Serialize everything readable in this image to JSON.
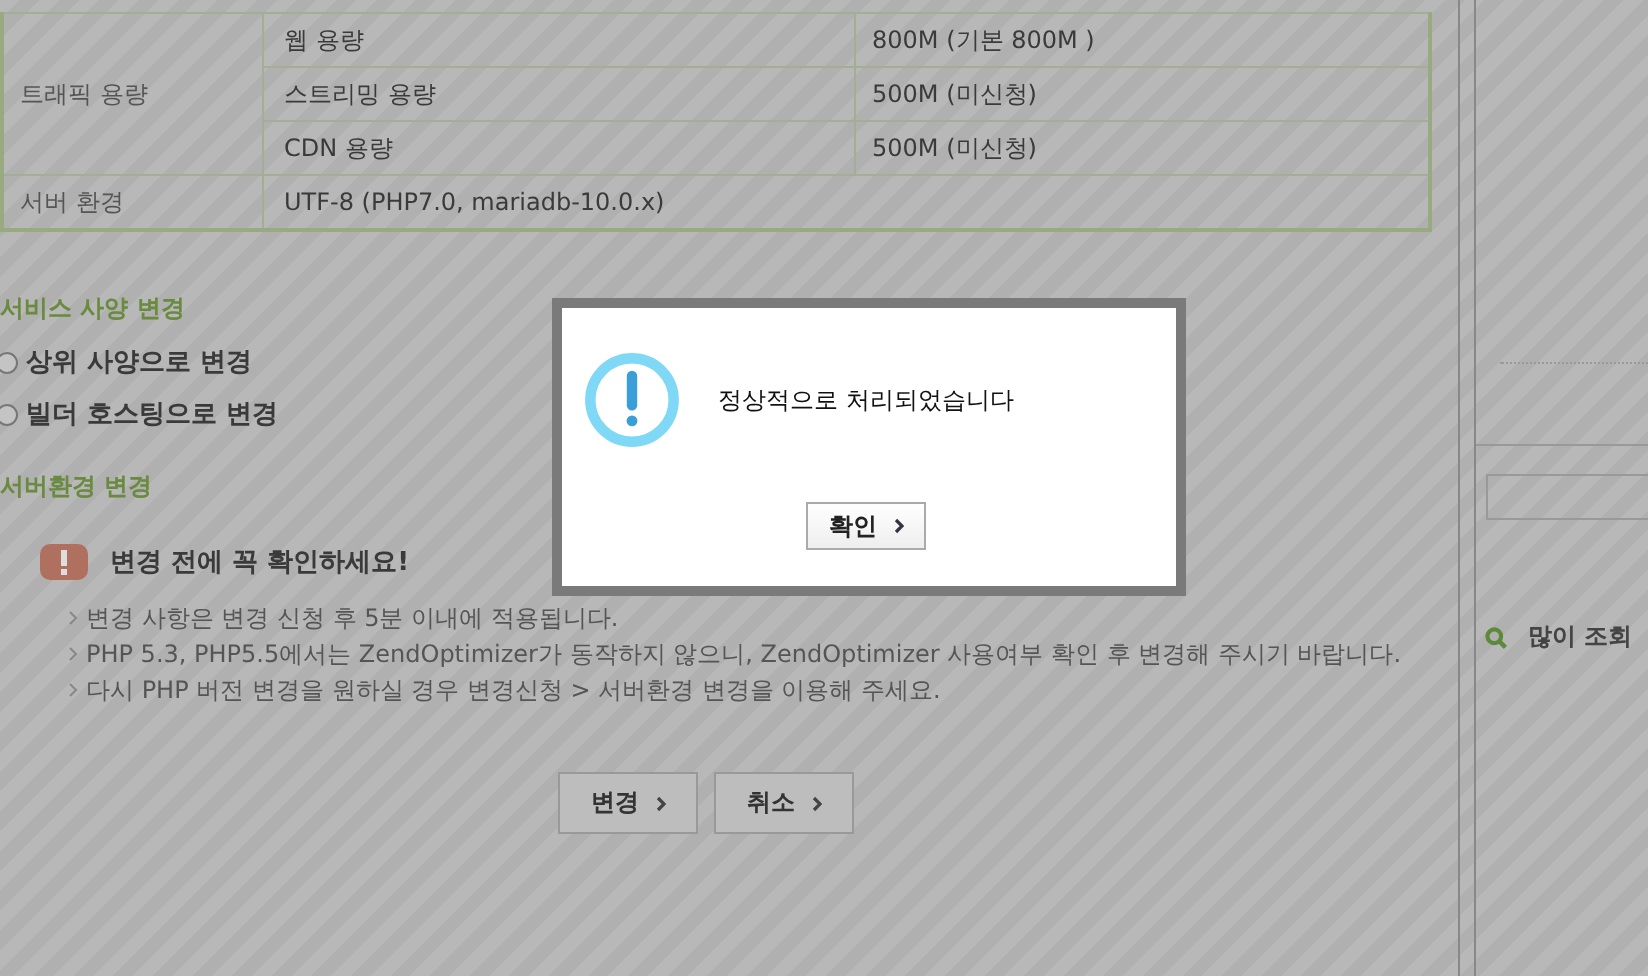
{
  "spec_table": {
    "groups": [
      {
        "label": "트래픽 용량",
        "rows": [
          {
            "name": "웹 용량",
            "value": "800M (기본 800M )"
          },
          {
            "name": "스트리밍 용량",
            "value": "500M (미신청)"
          },
          {
            "name": "CDN 용량",
            "value": "500M (미신청)"
          }
        ]
      },
      {
        "label": "서버 환경",
        "rows": [
          {
            "name": "UTF-8 (PHP7.0, mariadb-10.0.x)"
          }
        ]
      }
    ]
  },
  "service_change": {
    "heading": "서비스 사양 변경",
    "options": [
      {
        "label": "상위 사양으로 변경",
        "selected": false
      },
      {
        "label": "빌더 호스팅으로 변경",
        "selected": false
      }
    ]
  },
  "server_change": {
    "heading": "서버환경 변경",
    "notice_title": "변경 전에 꼭 확인하세요!",
    "notes": [
      "변경 사항은 변경 신청 후 5분 이내에 적용됩니다.",
      "PHP 5.3, PHP5.5에서는 ZendOptimizer가 동작하지 않으니, ZendOptimizer 사용여부 확인 후 변경해 주시기 바랍니다.",
      "다시 PHP 버전 변경을 원하실 경우 변경신청 > 서버환경 변경을 이용해 주세요."
    ]
  },
  "buttons": [
    "변경",
    "취소"
  ],
  "sidebar": {
    "heading": "많이 조회"
  },
  "dialog": {
    "message": "정상적으로 처리되었습니다",
    "button": "확인"
  }
}
